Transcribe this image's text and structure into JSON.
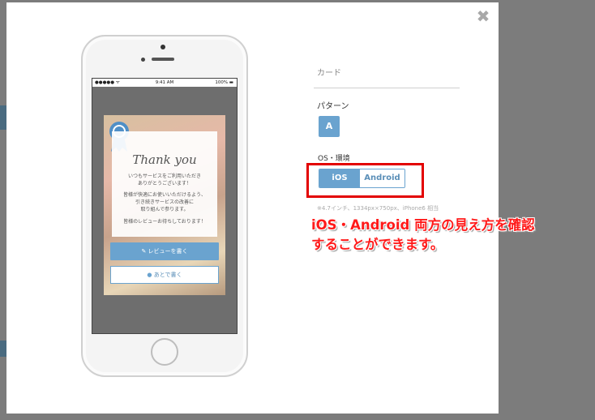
{
  "modal": {
    "close_label": "✖"
  },
  "phone": {
    "status": {
      "carrier": "●●●●● ᯤ",
      "time": "9:41 AM",
      "battery": "100% ▬"
    },
    "card": {
      "title": "Thank you",
      "line1": "いつもサービスをご利用いただき",
      "line2": "ありがとうございます！",
      "line3": "皆様が快適にお使いいただけるよう、",
      "line4": "引き続きサービスの改善に",
      "line5": "取り組んで参ります。",
      "line6": "皆様のレビューお待ちしております！",
      "review_button": "レビューを書く",
      "later_button": "あとで書く"
    }
  },
  "settings": {
    "card_label": "カード",
    "pattern_label": "パターン",
    "pattern_value": "A",
    "os_label": "OS・環境",
    "os_options": [
      "iOS",
      "Android"
    ],
    "spec_note": "※4.7インチ、1334px×750px、iPhone6 相当"
  },
  "annotation": {
    "line1": "iOS・Android 両方の見え方を確認",
    "line2": "することができます。"
  },
  "colors": {
    "accent": "#6aa3cf",
    "highlight": "#e30000"
  }
}
